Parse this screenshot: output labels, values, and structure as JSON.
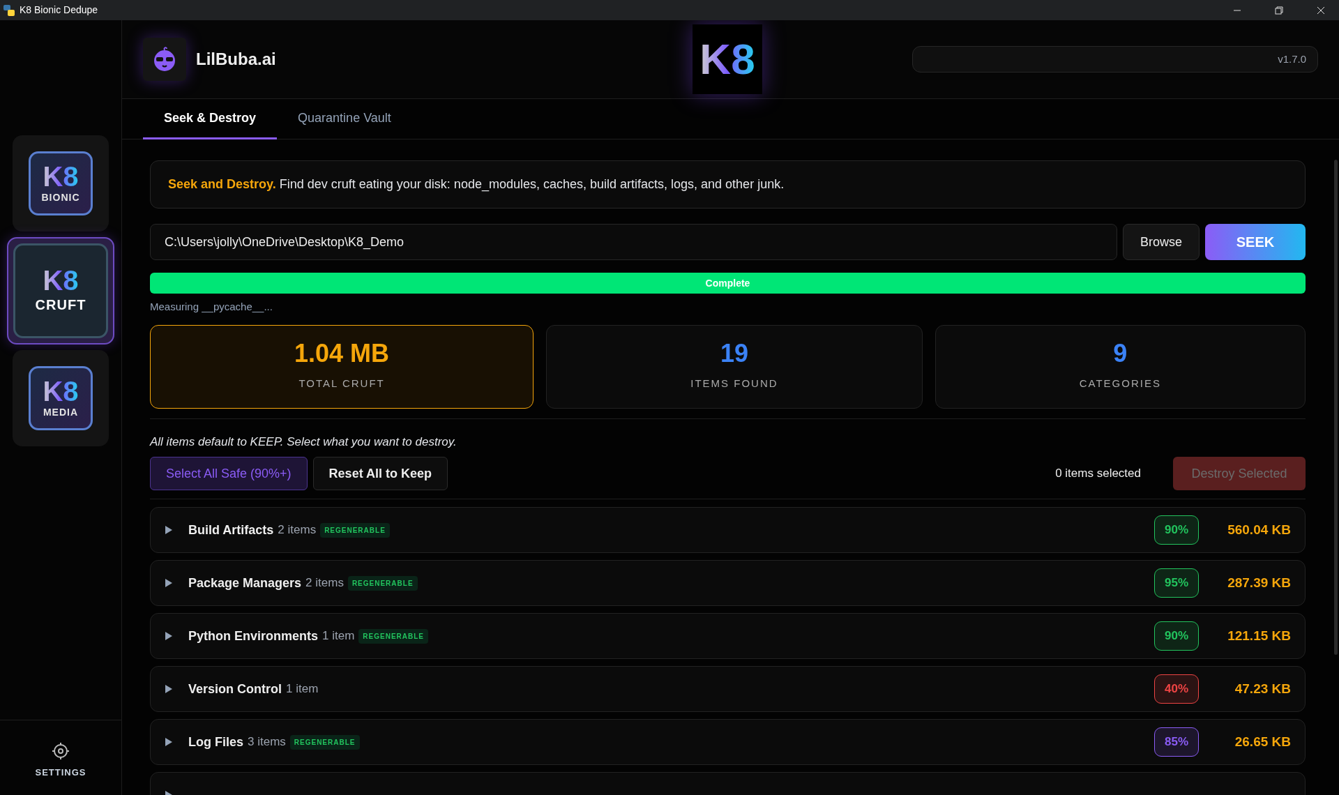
{
  "window": {
    "title": "K8 Bionic Dedupe"
  },
  "sidebar": {
    "apps": [
      {
        "mark": "K8",
        "label": "BIONIC",
        "selected": false
      },
      {
        "mark": "K8",
        "label": "CRUFT",
        "selected": true
      },
      {
        "mark": "K8",
        "label": "MEDIA",
        "selected": false
      }
    ],
    "settings": "SETTINGS"
  },
  "header": {
    "brand": "LilBuba.ai",
    "center_logo": "K8",
    "version": "v1.7.0"
  },
  "tabs": [
    {
      "label": "Seek & Destroy",
      "selected": true
    },
    {
      "label": "Quarantine Vault",
      "selected": false
    }
  ],
  "intro": {
    "lead": "Seek and Destroy.",
    "text": "Find dev cruft eating your disk: node_modules, caches, build artifacts, logs, and other junk."
  },
  "path_field": {
    "value": "C:\\Users\\jolly\\OneDrive\\Desktop\\K8_Demo"
  },
  "browse_button": "Browse",
  "seek_button": "SEEK",
  "progress": {
    "level": 1,
    "label": "Complete"
  },
  "status": "Measuring __pycache__...",
  "stats": [
    {
      "value": "1.04 MB",
      "label": "TOTAL CRUFT",
      "color": "#f5a60b",
      "highlighted": true
    },
    {
      "value": "19",
      "label": "ITEMS FOUND",
      "color": "#3b82f6",
      "highlighted": false
    },
    {
      "value": "9",
      "label": "CATEGORIES",
      "color": "#3b82f6",
      "highlighted": false
    }
  ],
  "hint": "All items default to KEEP. Select what you want to destroy.",
  "select_safe_button": "Select All Safe (90%+)",
  "reset_button": "Reset All to Keep",
  "selection_count": "0 items selected",
  "destroy_button": {
    "label": "Destroy Selected",
    "disabled": true
  },
  "categories": [
    {
      "name": "Build Artifacts",
      "count": "2 items",
      "tag": "REGENERABLE",
      "confidence": "90%",
      "color": "#22c55e",
      "size": "560.04 KB",
      "expanded": false
    },
    {
      "name": "Package Managers",
      "count": "2 items",
      "tag": "REGENERABLE",
      "confidence": "95%",
      "color": "#22c55e",
      "size": "287.39 KB",
      "expanded": false
    },
    {
      "name": "Python Environments",
      "count": "1 item",
      "tag": "REGENERABLE",
      "confidence": "90%",
      "color": "#22c55e",
      "size": "121.15 KB",
      "expanded": false
    },
    {
      "name": "Version Control",
      "count": "1 item",
      "confidence": "40%",
      "color": "#ef4444",
      "size": "47.23 KB",
      "expanded": false
    },
    {
      "name": "Log Files",
      "count": "3 items",
      "tag": "REGENERABLE",
      "confidence": "85%",
      "color": "#8b5cf6",
      "size": "26.65 KB",
      "expanded": false
    },
    {
      "expanded": false
    }
  ]
}
